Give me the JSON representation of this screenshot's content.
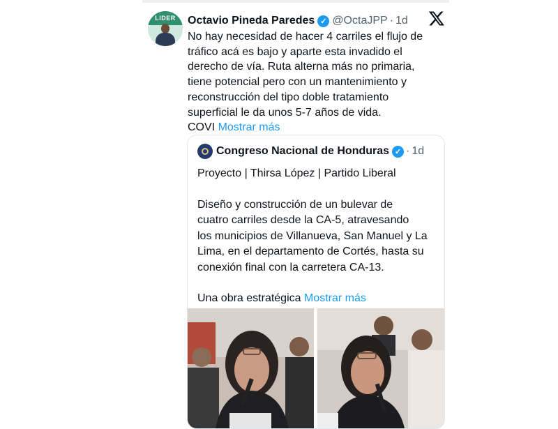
{
  "post": {
    "author_name": "Octavio Pineda Paredes",
    "handle": "@OctaJPP",
    "separator": "·",
    "time": "1d",
    "avatar_banner": "LIDER",
    "text_lines": [
      "No hay necesidad de hacer 4 carriles el flujo de",
      "tráfico acá es bajo y aparte esta invadido el",
      "derecho de vía. Ruta alterna más no primaria,",
      "tiene potencial pero con un mantenimiento y",
      "reconstrucción del tipo doble tratamiento",
      "superficial le da unos 5-7 años de vida."
    ],
    "last_line_prefix": "COVI",
    "show_more": "Mostrar más"
  },
  "quoted": {
    "author_name": "Congreso Nacional de Honduras",
    "separator": "·",
    "time": "1d",
    "line1": "Proyecto | Thirsa López | Partido Liberal",
    "paragraph_lines": [
      "Diseño y construcción de un bulevar de",
      "cuatro carriles desde la CA-5, atravesando",
      "los municipios de Villanueva, San Manuel y La",
      "Lima, en el departamento de Cortés, hasta su",
      "conexión final con la carretera CA-13."
    ],
    "last_line_prefix": "Una obra estratégica",
    "show_more": "Mostrar más"
  },
  "icons": {
    "verified": "verified-badge-icon",
    "platform": "x-logo-icon"
  },
  "colors": {
    "link": "#1d9bf0",
    "secondary_text": "#536471",
    "verified": "#1d9bf0"
  }
}
